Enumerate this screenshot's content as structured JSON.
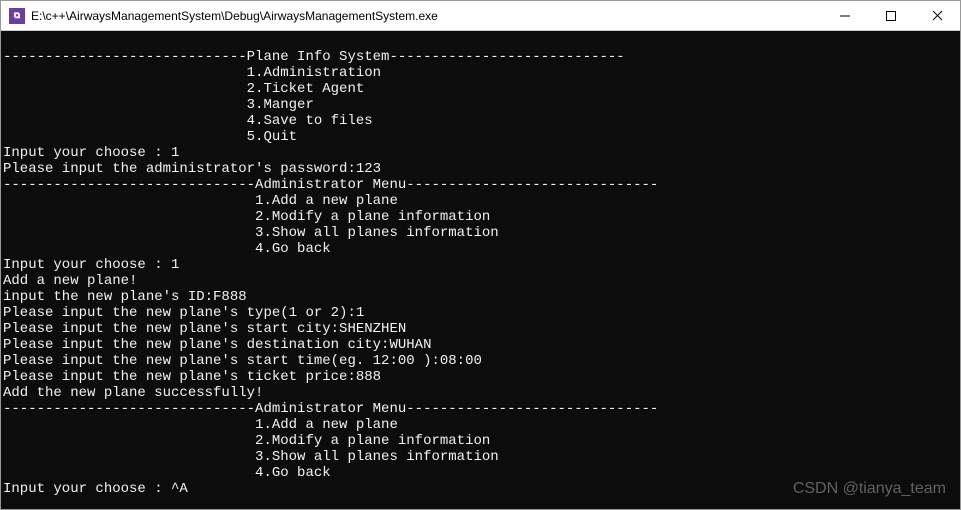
{
  "window": {
    "title": "E:\\c++\\AirwaysManagementSystem\\Debug\\AirwaysManagementSystem.exe",
    "icon_label": "app-icon"
  },
  "console": {
    "plane_info_header": "-----------------------------Plane Info System----------------------------",
    "plane_info_menu": {
      "item1": "                             1.Administration",
      "item2": "                             2.Ticket Agent",
      "item3": "                             3.Manger",
      "item4": "                             4.Save to files",
      "item5": "                             5.Quit"
    },
    "choose1": "Input your choose : 1",
    "password_line": "Please input the administrator's password:123",
    "admin_header": "------------------------------Administrator Menu------------------------------",
    "admin_menu": {
      "item1": "                              1.Add a new plane",
      "item2": "                              2.Modify a plane information",
      "item3": "                              3.Show all planes information",
      "item4": "                              4.Go back"
    },
    "choose2": "Input your choose : 1",
    "add_msg": "Add a new plane!",
    "in_id": "input the new plane's ID:F888",
    "in_type": "Please input the new plane's type(1 or 2):1",
    "in_start": "Please input the new plane's start city:SHENZHEN",
    "in_dest": "Please input the new plane's destination city:WUHAN",
    "in_time": "Please input the new plane's start time(eg. 12:00 ):08:00",
    "in_price": "Please input the new plane's ticket price:888",
    "add_success": "Add the new plane successfully!",
    "choose3": "Input your choose : ^A"
  },
  "watermark": "CSDN @tianya_team"
}
